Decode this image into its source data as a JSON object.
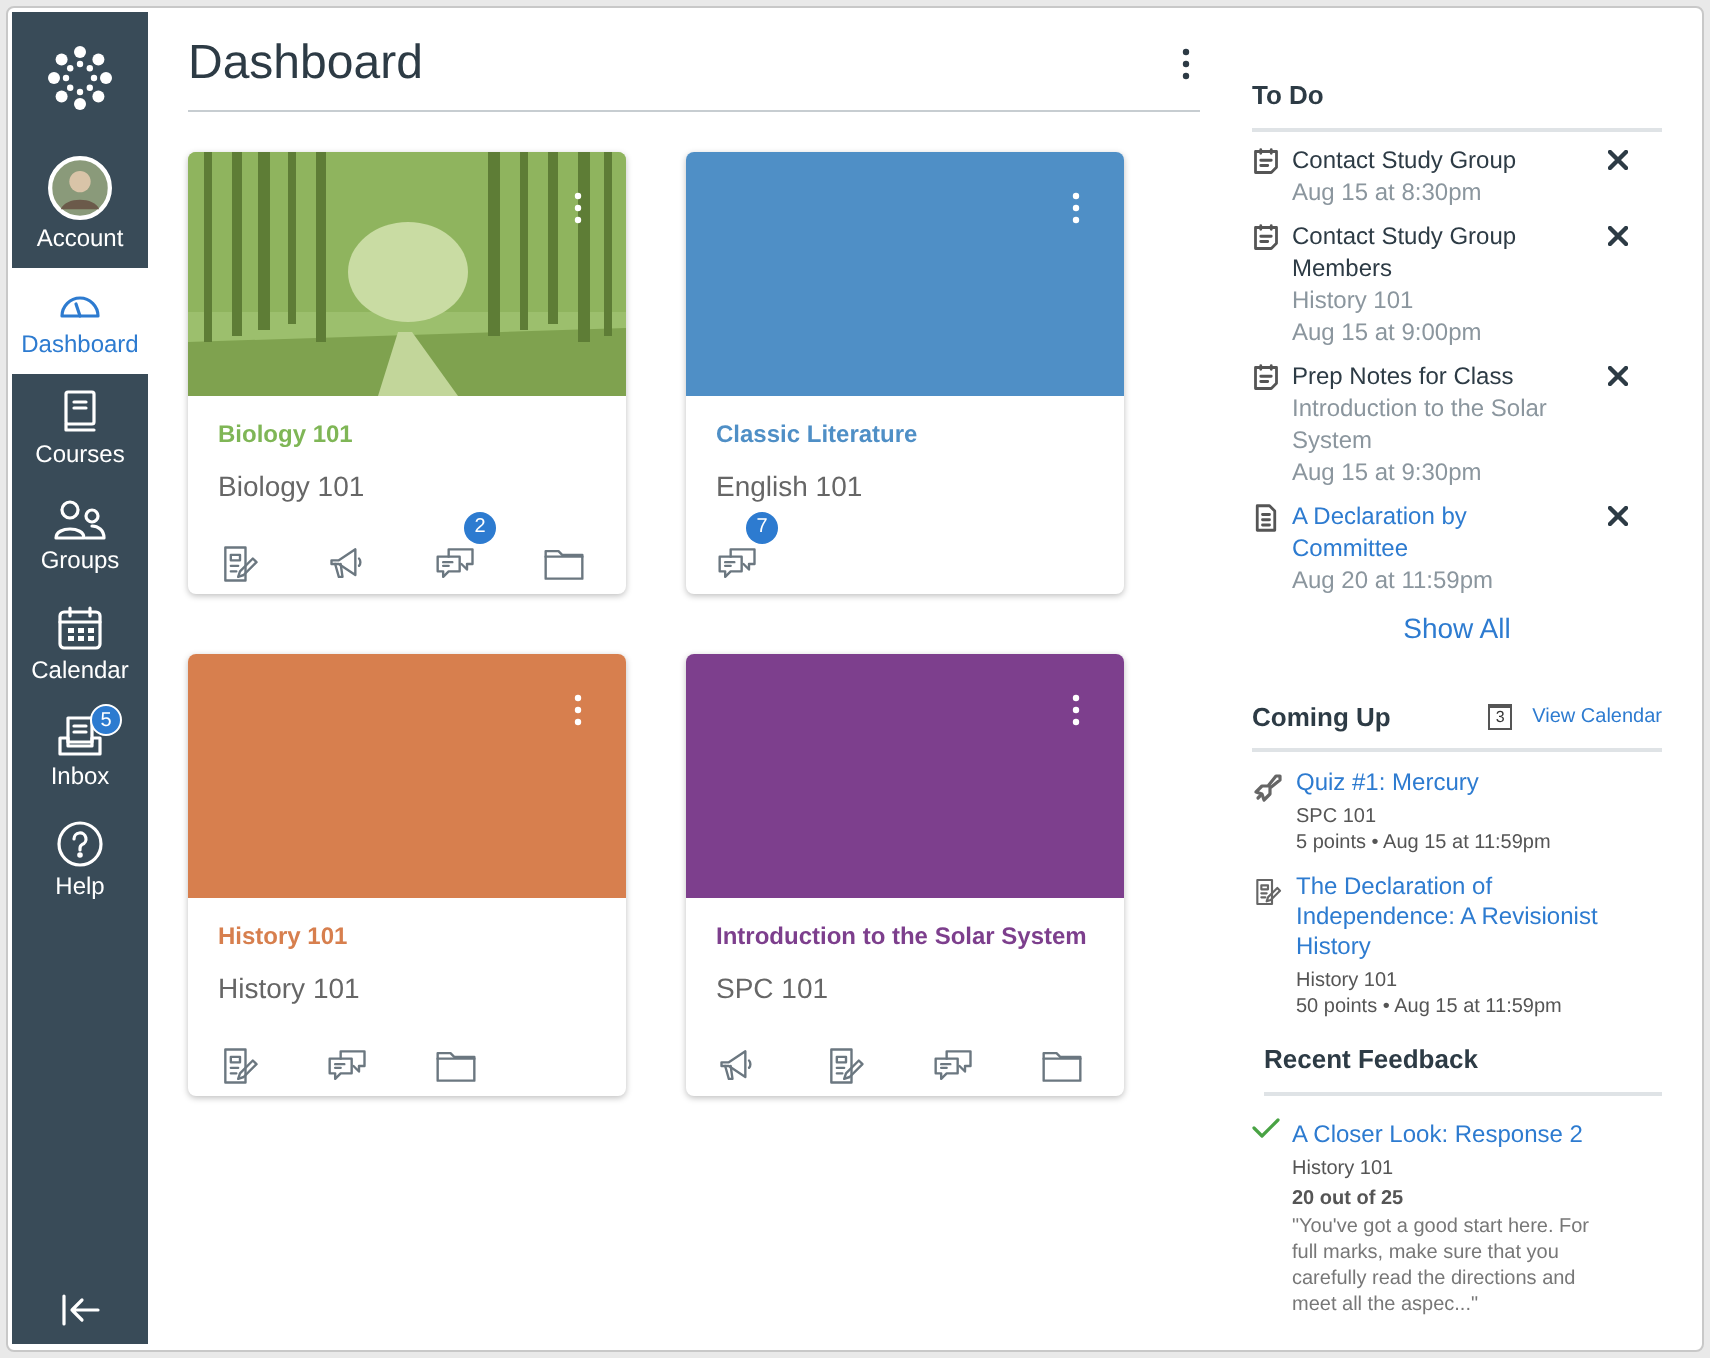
{
  "nav": {
    "items": [
      {
        "kind": "logo",
        "selected": false
      },
      {
        "kind": "account",
        "label": "Account",
        "selected": false
      },
      {
        "kind": "dashboard",
        "label": "Dashboard",
        "selected": true
      },
      {
        "kind": "courses",
        "label": "Courses",
        "selected": false
      },
      {
        "kind": "groups",
        "label": "Groups",
        "selected": false
      },
      {
        "kind": "calendar",
        "label": "Calendar",
        "selected": false
      },
      {
        "kind": "inbox",
        "label": "Inbox",
        "selected": false,
        "badge": "5"
      },
      {
        "kind": "help",
        "label": "Help",
        "selected": false
      }
    ]
  },
  "dashboard": {
    "title": "Dashboard",
    "cards": [
      {
        "title": "Biology 101",
        "subtitle": "Biology 101",
        "color": "#7fb656",
        "kind": "picture",
        "actions": [
          {
            "kind": "assignments"
          },
          {
            "kind": "announcements"
          },
          {
            "kind": "discussions",
            "badge": "2"
          },
          {
            "kind": "files"
          }
        ]
      },
      {
        "title": "Classic Literature",
        "subtitle": "English 101",
        "color": "#4f8fc6",
        "kind": "color",
        "actions": [
          {
            "kind": "discussions",
            "badge": "7"
          }
        ]
      },
      {
        "title": "History 101",
        "subtitle": "History 101",
        "color": "#d77f4e",
        "kind": "color",
        "actions": [
          {
            "kind": "assignments"
          },
          {
            "kind": "discussions"
          },
          {
            "kind": "files"
          }
        ]
      },
      {
        "title": "Introduction to the Solar System",
        "subtitle": "SPC 101",
        "color": "#7d3f8d",
        "kind": "color",
        "actions": [
          {
            "kind": "announcements"
          },
          {
            "kind": "assignments"
          },
          {
            "kind": "discussions"
          },
          {
            "kind": "files"
          }
        ]
      }
    ]
  },
  "todo": {
    "heading": "To Do",
    "items": [
      {
        "kind": "note",
        "title": "Contact Study Group",
        "date": "Aug 15 at 8:30pm"
      },
      {
        "kind": "note",
        "title": "Contact Study Group Members",
        "course": "History 101",
        "date": "Aug 15 at 9:00pm"
      },
      {
        "kind": "note",
        "title": "Prep Notes for Class",
        "course": "Introduction to the Solar System",
        "date": "Aug 15 at 9:30pm"
      },
      {
        "kind": "page",
        "title": "A Declaration by Committee",
        "date": "Aug 20 at 11:59pm"
      }
    ],
    "show_all": "Show All"
  },
  "coming_up": {
    "heading": "Coming Up",
    "view_calendar": "View Calendar",
    "calendar_day": "3",
    "items": [
      {
        "kind": "quiz",
        "title": "Quiz #1: Mercury",
        "course": "SPC 101",
        "details": "5 points • Aug 15 at 11:59pm"
      },
      {
        "kind": "assignment",
        "title": "The Declaration of Independence: A Revisionist History",
        "course": "History 101",
        "details": "50 points • Aug 15 at 11:59pm"
      }
    ]
  },
  "recent_feedback": {
    "heading": "Recent Feedback",
    "items": [
      {
        "title": "A Closer Look: Response 2",
        "course": "History 101",
        "score": "20 out of 25",
        "comment": "\"You've got a good start here. For full marks, make sure that you carefully read the directions and meet all the aspec...\""
      }
    ]
  }
}
